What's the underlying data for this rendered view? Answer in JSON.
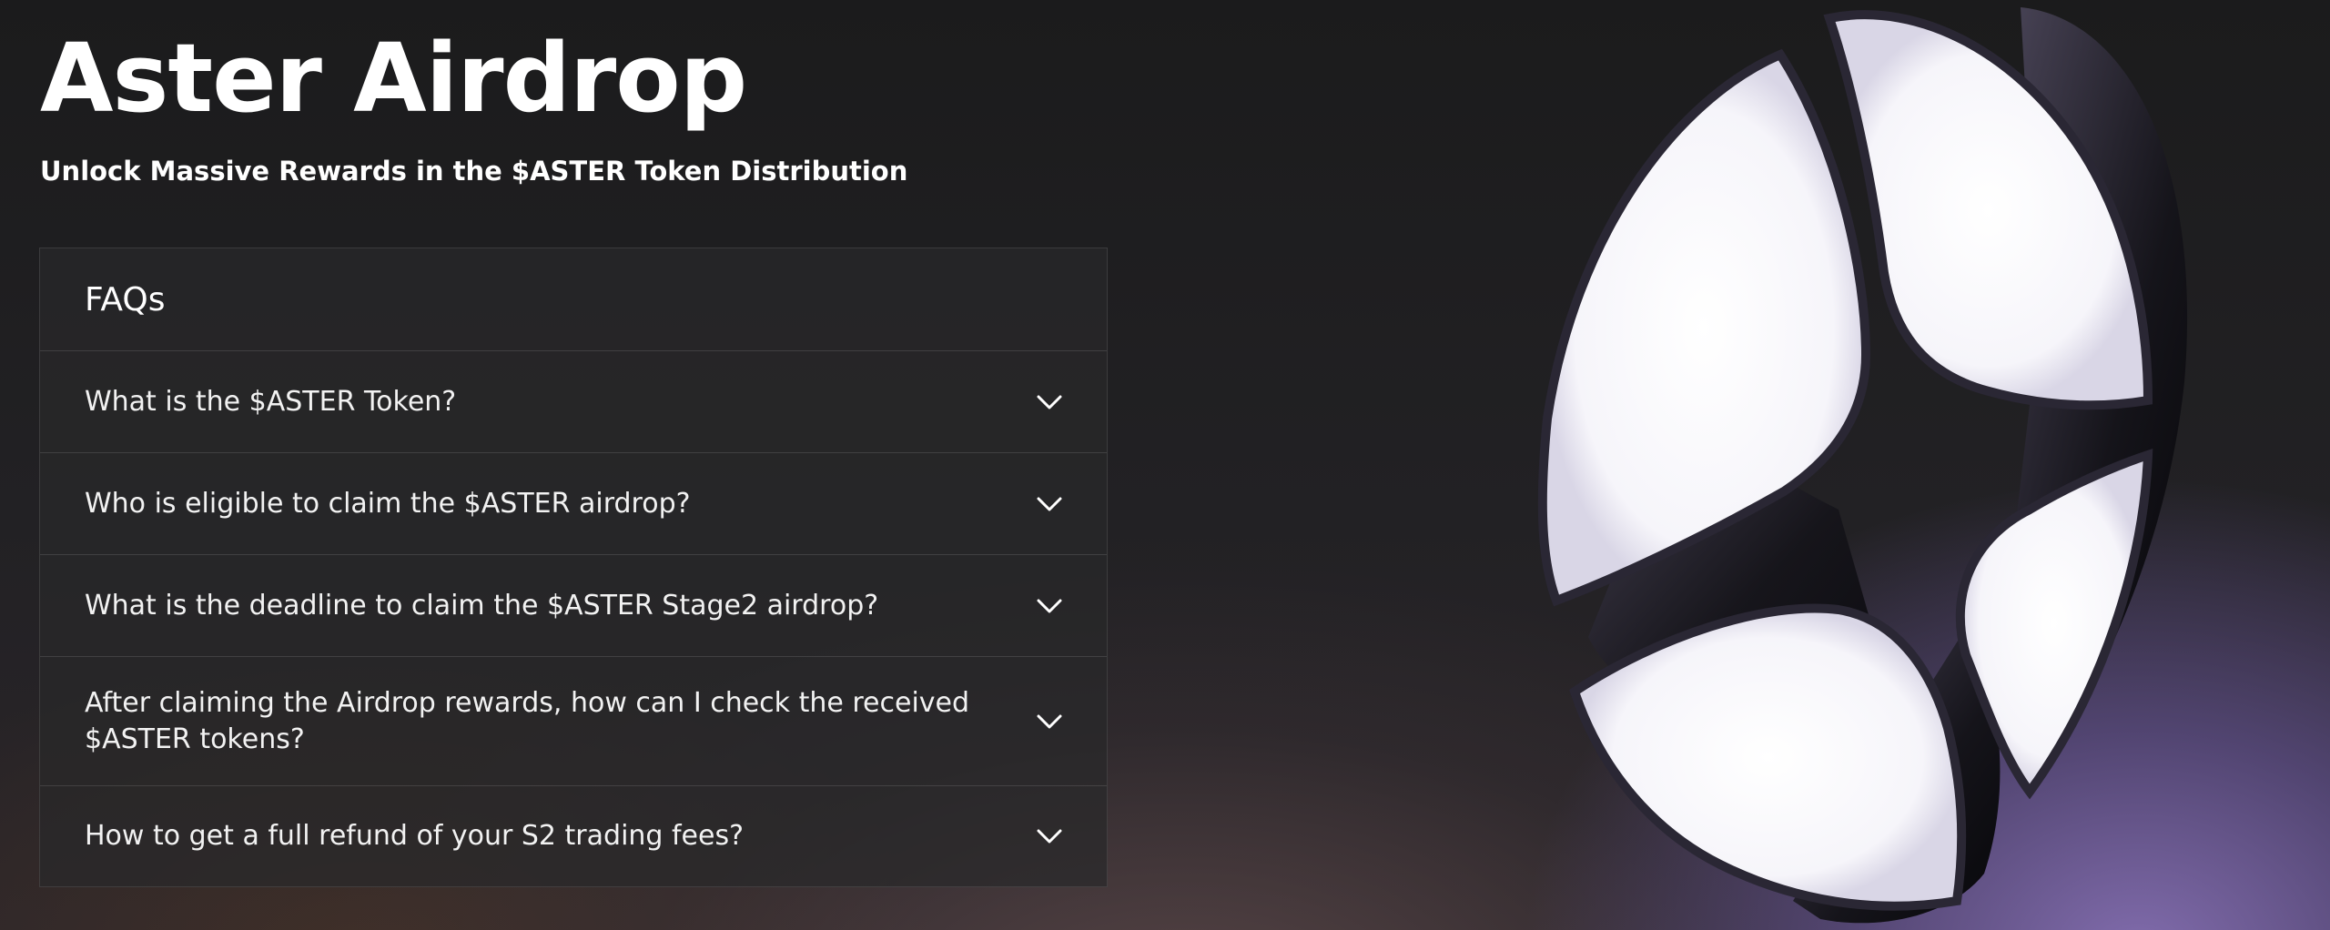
{
  "hero": {
    "title": "Aster Airdrop",
    "subtitle": "Unlock Massive Rewards in the $ASTER Token Distribution"
  },
  "faq": {
    "heading": "FAQs",
    "items": [
      {
        "question": "What is the $ASTER Token?",
        "icon": "chevron-down-icon"
      },
      {
        "question": "Who is eligible to claim the $ASTER airdrop?",
        "icon": "chevron-down-icon"
      },
      {
        "question": "What is the deadline to claim the $ASTER Stage2 airdrop?",
        "icon": "chevron-down-icon"
      },
      {
        "question": "After claiming the Airdrop rewards, how can I check the received $ASTER tokens?",
        "icon": "chevron-down-icon"
      },
      {
        "question": "How to get a full refund of your S2 trading fees?",
        "icon": "chevron-down-icon"
      }
    ]
  },
  "colors": {
    "background": "#1c1c1d",
    "accent_glow": "#8670b4",
    "text": "#ffffff"
  }
}
